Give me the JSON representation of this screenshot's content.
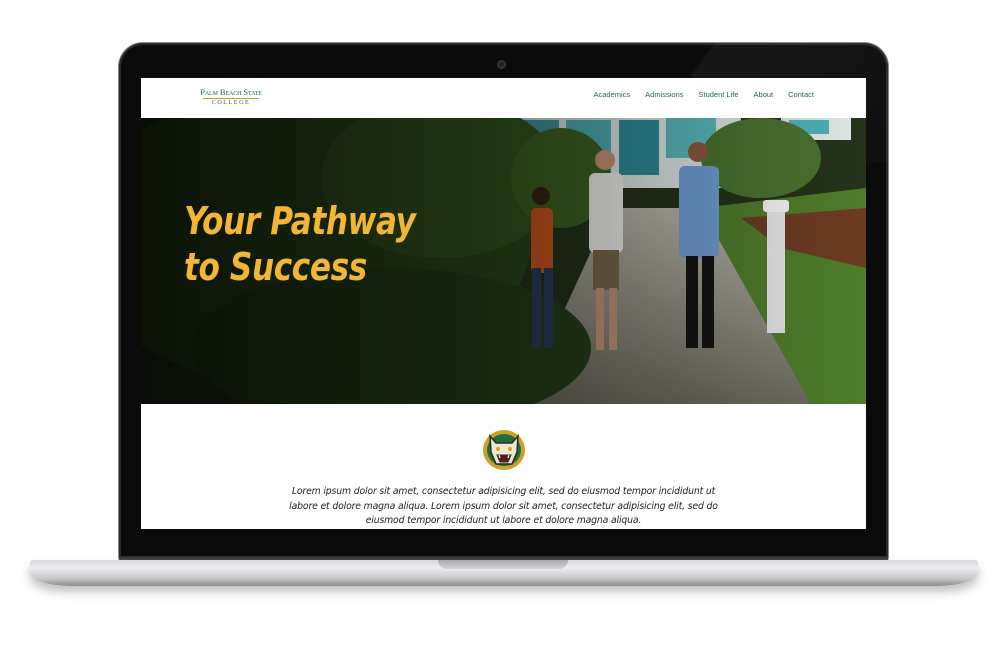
{
  "site": {
    "logo": {
      "line1": "Palm Beach State",
      "line2": "College"
    },
    "nav": [
      "Academics",
      "Admissions",
      "Student Life",
      "About",
      "Contact"
    ],
    "hero": {
      "title_line1": "Your Pathway",
      "title_line2": "to Success"
    },
    "intro": "Lorem ipsum dolor sit amet, consectetur adipisicing elit, sed do eiusmod tempor incididunt ut labore et dolore magna aliqua. Lorem ipsum dolor sit amet, consectetur adipisicing elit, sed do eiusmod tempor incididunt ut labore et dolore magna aliqua."
  },
  "colors": {
    "brand_green": "#1f6e3e",
    "accent_gold": "#f2b534",
    "device_bezel": "#0b0b0b"
  },
  "icons": {
    "mascot": "panther-head-icon"
  }
}
